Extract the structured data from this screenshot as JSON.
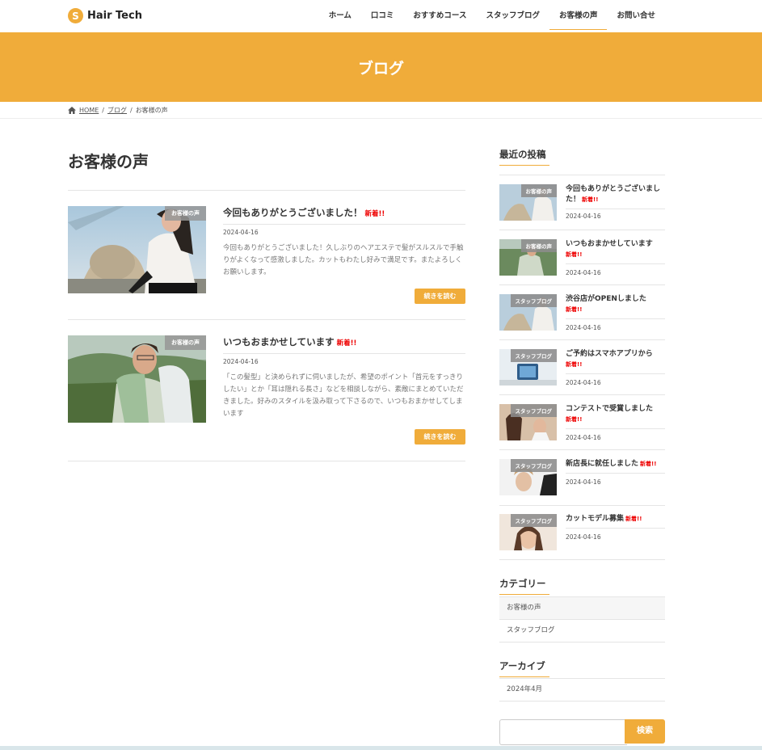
{
  "brand": {
    "mark": "S",
    "name": "Hair Tech",
    "accent": "#f0ac3a"
  },
  "nav": [
    {
      "label": "ホーム"
    },
    {
      "label": "口コミ"
    },
    {
      "label": "おすすめコース"
    },
    {
      "label": "スタッフブログ"
    },
    {
      "label": "お客様の声",
      "active": true
    },
    {
      "label": "お問い合せ"
    }
  ],
  "banner": {
    "title": "ブログ"
  },
  "breadcrumb": {
    "home": "HOME",
    "sep": "/",
    "blog": "ブログ",
    "current": "お客様の声"
  },
  "page": {
    "title": "お客様の声"
  },
  "posts": [
    {
      "category": "お客様の声",
      "title": "今回もありがとうございました！",
      "new": "新着!!",
      "date": "2024-04-16",
      "excerpt": "今回もありがとうございました！久しぶりのヘアエステで髪がスルスルで手触りがよくなって感激しました。カットもわたし好みで満足です。またよろしくお願いします。",
      "more": "続きを読む"
    },
    {
      "category": "お客様の声",
      "title": "いつもおまかせしています",
      "new": "新着!!",
      "date": "2024-04-16",
      "excerpt": "「この髪型」と決められずに伺いましたが、希望のポイント「首元をすっきりしたい」とか「耳は隠れる長さ」などを相談しながら、素敵にまとめていただきました。好みのスタイルを汲み取って下さるので、いつもおまかせしてしまいます",
      "more": "続きを読む"
    }
  ],
  "sidebar": {
    "recent_heading": "最近の投稿",
    "recent": [
      {
        "category": "お客様の声",
        "title": "今回もありがとうございました！",
        "new": "新着!!",
        "date": "2024-04-16"
      },
      {
        "category": "お客様の声",
        "title": "いつもおまかせしています",
        "new": "新着!!",
        "date": "2024-04-16"
      },
      {
        "category": "スタッフブログ",
        "title": "渋谷店がOPENしました",
        "new": "新着!!",
        "date": "2024-04-16"
      },
      {
        "category": "スタッフブログ",
        "title": "ご予約はスマホアプリから",
        "new": "新着!!",
        "date": "2024-04-16"
      },
      {
        "category": "スタッフブログ",
        "title": "コンテストで受賞しました",
        "new": "新着!!",
        "date": "2024-04-16"
      },
      {
        "category": "スタッフブログ",
        "title": "新店長に就任しました",
        "new": "新着!!",
        "date": "2024-04-16"
      },
      {
        "category": "スタッフブログ",
        "title": "カットモデル募集",
        "new": "新着!!",
        "date": "2024-04-16"
      }
    ],
    "category_heading": "カテゴリー",
    "categories": [
      {
        "label": "お客様の声"
      },
      {
        "label": "スタッフブログ"
      }
    ],
    "archive_heading": "アーカイブ",
    "archives": [
      {
        "label": "2024年4月"
      }
    ],
    "search": {
      "placeholder": "",
      "button": "検索"
    }
  }
}
